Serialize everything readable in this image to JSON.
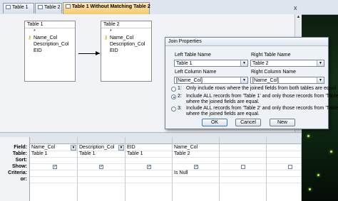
{
  "tabs": [
    {
      "label": "Table 1",
      "active": false
    },
    {
      "label": "Table 2",
      "active": false
    },
    {
      "label": "Table 1 Without Matching Table 2",
      "active": true
    }
  ],
  "close_glyph": "x",
  "tables": [
    {
      "title": "Table 1",
      "fields": [
        "*",
        "Name_Col",
        "Description_Col",
        "EID"
      ]
    },
    {
      "title": "Table 2",
      "fields": [
        "*",
        "Name_Col",
        "Description_Col",
        "EID"
      ]
    }
  ],
  "dialog": {
    "title": "Join Properties",
    "left_table_label": "Left Table Name",
    "right_table_label": "Right Table Name",
    "left_table_value": "Table 1",
    "right_table_value": "Table 2",
    "left_column_label": "Left Column Name",
    "right_column_label": "Right Column Name",
    "left_column_value": "[Name_Col]",
    "right_column_value": "[Name_Col]",
    "options": [
      {
        "num": "1:",
        "line1": "Only include rows where the joined fields from both tables are equal.",
        "line2": "",
        "selected": false
      },
      {
        "num": "2:",
        "line1": "Include ALL records from 'Table 1' and only those records from 'Table 2'",
        "line2": "where the joined fields are equal.",
        "selected": true
      },
      {
        "num": "3:",
        "line1": "Include ALL records from 'Table 2' and only those records from 'Table 1'",
        "line2": "where the joined fields are equal.",
        "selected": false
      }
    ],
    "ok_label": "OK",
    "cancel_label": "Cancel",
    "new_label": "New"
  },
  "grid": {
    "row_labels": [
      "Field:",
      "Table:",
      "Sort:",
      "Show:",
      "Criteria:",
      "or:"
    ],
    "columns": [
      {
        "field": "Name_Col",
        "table": "Table 1",
        "show": true,
        "criteria": ""
      },
      {
        "field": "Description_Col",
        "table": "Table 1",
        "show": true,
        "criteria": ""
      },
      {
        "field": "EID",
        "table": "Table 1",
        "show": true,
        "criteria": ""
      },
      {
        "field": "Name_Col",
        "table": "Table 2",
        "show": true,
        "criteria": "Is Null"
      },
      {
        "field": "",
        "table": "",
        "show": false,
        "criteria": ""
      },
      {
        "field": "",
        "table": "",
        "show": false,
        "criteria": ""
      }
    ]
  },
  "colors": {
    "active_tab": "#f6c86a",
    "selection_blue": "#1a56b0",
    "desktop_green": "#163018"
  }
}
